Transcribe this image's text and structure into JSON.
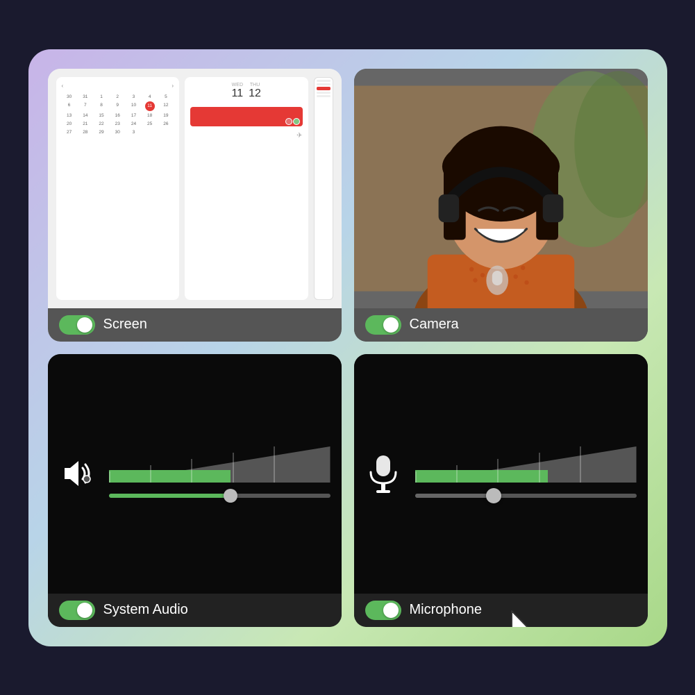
{
  "background": {
    "gradient_from": "#c8b4e8",
    "gradient_to": "#a8d888"
  },
  "cards": {
    "screen": {
      "label": "Screen",
      "toggle_state": "on",
      "calendar": {
        "days": [
          "30",
          "31",
          "1",
          "2",
          "3",
          "4",
          "5",
          "6",
          "7",
          "8",
          "9",
          "10",
          "11",
          "12",
          "13",
          "14",
          "15",
          "16",
          "17",
          "18",
          "19",
          "20",
          "21",
          "22",
          "23",
          "24",
          "25",
          "26",
          "27",
          "28",
          "29",
          "30",
          "3"
        ],
        "today": "11",
        "date1": "11",
        "date2": "12",
        "date1_label": "WED",
        "date2_label": "THU"
      }
    },
    "camera": {
      "label": "Camera",
      "toggle_state": "on"
    },
    "system_audio": {
      "label": "System Audio",
      "toggle_state": "on",
      "volume_level": 55
    },
    "microphone": {
      "label": "Microphone",
      "toggle_state": "on",
      "volume_level": 40
    }
  },
  "cursor": {
    "visible": true
  }
}
